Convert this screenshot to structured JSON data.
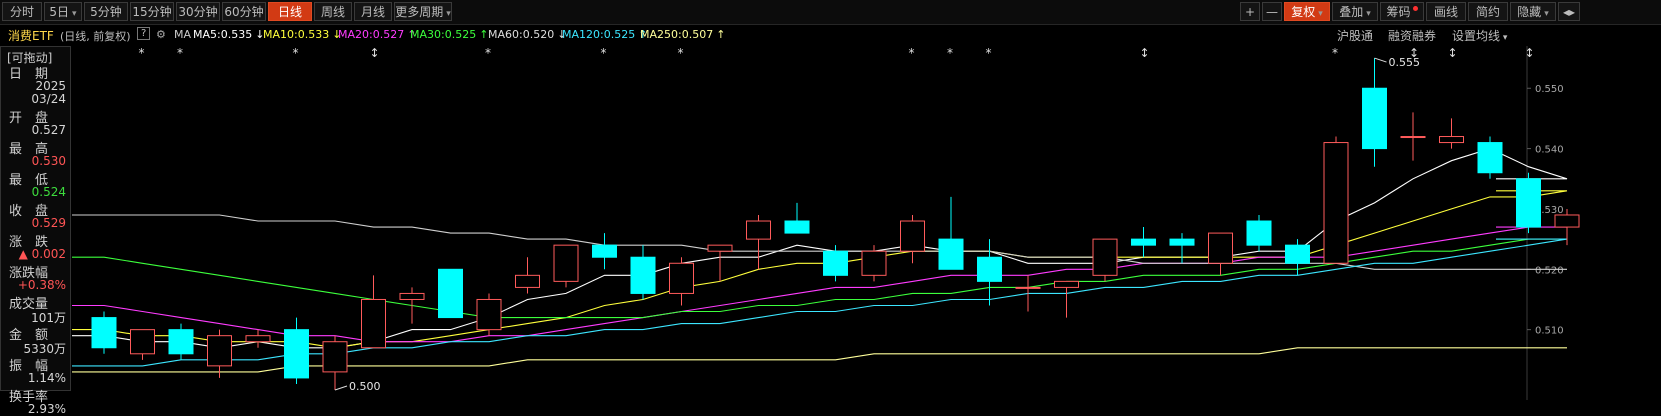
{
  "toolbar": {
    "periods": [
      "分时",
      "5日",
      "5分钟",
      "15分钟",
      "30分钟",
      "60分钟",
      "日线",
      "周线",
      "月线",
      "更多周期"
    ],
    "active_period": "日线",
    "right_buttons": [
      "+",
      "—",
      "复权",
      "叠加",
      "筹码",
      "画线",
      "简约",
      "隐藏",
      "◂▸"
    ]
  },
  "legend": {
    "name": "消费ETF",
    "subtitle": "(日线, 前复权)",
    "help": "?",
    "indicator": "MA",
    "ma": [
      {
        "text": "MA5:0.535",
        "arrow": "↓",
        "color": "#ffffff"
      },
      {
        "text": "MA10:0.533",
        "arrow": "↓",
        "color": "#ffff3c"
      },
      {
        "text": "MA20:0.527",
        "arrow": "↑",
        "color": "#ff3cff"
      },
      {
        "text": "MA30:0.525",
        "arrow": "↑",
        "color": "#3cff3c"
      },
      {
        "text": "MA60:0.520",
        "arrow": "↓",
        "color": "#dddddd"
      },
      {
        "text": "MA120:0.525",
        "arrow": "↑",
        "color": "#3ce6ff"
      },
      {
        "text": "MA250:0.507",
        "arrow": "↑",
        "color": "#ffff9a"
      }
    ],
    "right_links": [
      "沪股通",
      "融资融券",
      "设置均线"
    ]
  },
  "info_panel": {
    "tag": "[可拖动]",
    "rows": [
      {
        "label": "日　期",
        "value": [
          "2025",
          "03/24"
        ],
        "color": "white"
      },
      {
        "label": "开　盘",
        "value": [
          "0.527"
        ],
        "color": "white"
      },
      {
        "label": "最　高",
        "value": [
          "0.530"
        ],
        "color": "red"
      },
      {
        "label": "最　低",
        "value": [
          "0.524"
        ],
        "color": "green"
      },
      {
        "label": "收　盘",
        "value": [
          "0.529"
        ],
        "color": "red"
      },
      {
        "label": "涨　跌",
        "value": [
          "▲ 0.002"
        ],
        "color": "red"
      },
      {
        "label": "涨跌幅",
        "value": [
          "+0.38%"
        ],
        "color": "red"
      },
      {
        "label": "成交量",
        "value": [
          "101万"
        ],
        "color": "white"
      },
      {
        "label": "金　额",
        "value": [
          "5330万"
        ],
        "color": "white"
      },
      {
        "label": "振　幅",
        "value": [
          "1.14%"
        ],
        "color": "white"
      },
      {
        "label": "换手率",
        "value": [
          "2.93%"
        ],
        "color": "white"
      }
    ]
  },
  "chart_data": {
    "type": "candlestick",
    "y_ticks": [
      "0.550",
      "0.540",
      "0.530",
      "0.520",
      "0.510"
    ],
    "ylim": [
      0.5,
      0.557
    ],
    "colors": {
      "up": "#ff5b5b",
      "down": "#00ffff"
    },
    "candles": [
      {
        "o": 0.512,
        "h": 0.513,
        "l": 0.506,
        "c": 0.507
      },
      {
        "o": 0.506,
        "h": 0.51,
        "l": 0.505,
        "c": 0.51
      },
      {
        "o": 0.51,
        "h": 0.511,
        "l": 0.505,
        "c": 0.506
      },
      {
        "o": 0.504,
        "h": 0.51,
        "l": 0.502,
        "c": 0.509
      },
      {
        "o": 0.508,
        "h": 0.51,
        "l": 0.507,
        "c": 0.509
      },
      {
        "o": 0.51,
        "h": 0.512,
        "l": 0.501,
        "c": 0.502
      },
      {
        "o": 0.503,
        "h": 0.509,
        "l": 0.5,
        "c": 0.508
      },
      {
        "o": 0.507,
        "h": 0.519,
        "l": 0.507,
        "c": 0.515
      },
      {
        "o": 0.515,
        "h": 0.517,
        "l": 0.511,
        "c": 0.516
      },
      {
        "o": 0.52,
        "h": 0.52,
        "l": 0.512,
        "c": 0.512
      },
      {
        "o": 0.51,
        "h": 0.516,
        "l": 0.509,
        "c": 0.515
      },
      {
        "o": 0.517,
        "h": 0.522,
        "l": 0.516,
        "c": 0.519
      },
      {
        "o": 0.518,
        "h": 0.524,
        "l": 0.517,
        "c": 0.524
      },
      {
        "o": 0.524,
        "h": 0.526,
        "l": 0.52,
        "c": 0.522
      },
      {
        "o": 0.522,
        "h": 0.524,
        "l": 0.515,
        "c": 0.516
      },
      {
        "o": 0.516,
        "h": 0.522,
        "l": 0.514,
        "c": 0.521
      },
      {
        "o": 0.523,
        "h": 0.524,
        "l": 0.518,
        "c": 0.524
      },
      {
        "o": 0.525,
        "h": 0.529,
        "l": 0.52,
        "c": 0.528
      },
      {
        "o": 0.528,
        "h": 0.531,
        "l": 0.526,
        "c": 0.526
      },
      {
        "o": 0.523,
        "h": 0.524,
        "l": 0.518,
        "c": 0.519
      },
      {
        "o": 0.519,
        "h": 0.524,
        "l": 0.518,
        "c": 0.523
      },
      {
        "o": 0.523,
        "h": 0.529,
        "l": 0.521,
        "c": 0.528
      },
      {
        "o": 0.525,
        "h": 0.532,
        "l": 0.52,
        "c": 0.52
      },
      {
        "o": 0.522,
        "h": 0.525,
        "l": 0.514,
        "c": 0.518
      },
      {
        "o": 0.517,
        "h": 0.519,
        "l": 0.513,
        "c": 0.517
      },
      {
        "o": 0.517,
        "h": 0.518,
        "l": 0.512,
        "c": 0.518
      },
      {
        "o": 0.519,
        "h": 0.525,
        "l": 0.518,
        "c": 0.525
      },
      {
        "o": 0.525,
        "h": 0.527,
        "l": 0.522,
        "c": 0.524
      },
      {
        "o": 0.525,
        "h": 0.526,
        "l": 0.521,
        "c": 0.524
      },
      {
        "o": 0.521,
        "h": 0.526,
        "l": 0.519,
        "c": 0.526
      },
      {
        "o": 0.528,
        "h": 0.529,
        "l": 0.523,
        "c": 0.524
      },
      {
        "o": 0.524,
        "h": 0.525,
        "l": 0.519,
        "c": 0.521
      },
      {
        "o": 0.521,
        "h": 0.542,
        "l": 0.521,
        "c": 0.541
      },
      {
        "o": 0.55,
        "h": 0.555,
        "l": 0.537,
        "c": 0.54
      },
      {
        "o": 0.542,
        "h": 0.546,
        "l": 0.538,
        "c": 0.542
      },
      {
        "o": 0.541,
        "h": 0.545,
        "l": 0.54,
        "c": 0.542
      },
      {
        "o": 0.541,
        "h": 0.542,
        "l": 0.535,
        "c": 0.536
      },
      {
        "o": 0.535,
        "h": 0.536,
        "l": 0.526,
        "c": 0.527
      },
      {
        "o": 0.527,
        "h": 0.53,
        "l": 0.524,
        "c": 0.529
      }
    ],
    "ma_lines": [
      {
        "name": "MA5",
        "color": "#ffffff",
        "values": [
          0.509,
          0.508,
          0.508,
          0.507,
          0.508,
          0.507,
          0.507,
          0.508,
          0.51,
          0.51,
          0.512,
          0.515,
          0.516,
          0.519,
          0.519,
          0.521,
          0.522,
          0.522,
          0.524,
          0.523,
          0.523,
          0.524,
          0.523,
          0.523,
          0.521,
          0.521,
          0.521,
          0.522,
          0.522,
          0.522,
          0.523,
          0.523,
          0.528,
          0.531,
          0.535,
          0.538,
          0.54,
          0.537,
          0.535
        ]
      },
      {
        "name": "MA10",
        "color": "#ffff3c",
        "values": [
          0.51,
          0.509,
          0.509,
          0.508,
          0.508,
          0.508,
          0.507,
          0.508,
          0.508,
          0.509,
          0.51,
          0.511,
          0.512,
          0.514,
          0.515,
          0.517,
          0.518,
          0.52,
          0.521,
          0.521,
          0.522,
          0.523,
          0.523,
          0.523,
          0.522,
          0.522,
          0.522,
          0.522,
          0.522,
          0.522,
          0.522,
          0.522,
          0.524,
          0.526,
          0.528,
          0.53,
          0.532,
          0.532,
          0.533
        ]
      },
      {
        "name": "MA20",
        "color": "#ff3cff",
        "values": [
          0.514,
          0.513,
          0.512,
          0.511,
          0.51,
          0.509,
          0.509,
          0.508,
          0.508,
          0.508,
          0.509,
          0.509,
          0.51,
          0.511,
          0.512,
          0.513,
          0.514,
          0.515,
          0.516,
          0.517,
          0.517,
          0.518,
          0.519,
          0.519,
          0.519,
          0.52,
          0.52,
          0.521,
          0.521,
          0.521,
          0.522,
          0.522,
          0.522,
          0.523,
          0.524,
          0.525,
          0.526,
          0.527,
          0.527
        ]
      },
      {
        "name": "MA30",
        "color": "#3cff3c",
        "values": [
          0.522,
          0.521,
          0.52,
          0.519,
          0.518,
          0.517,
          0.516,
          0.515,
          0.514,
          0.513,
          0.512,
          0.512,
          0.512,
          0.512,
          0.512,
          0.513,
          0.513,
          0.514,
          0.514,
          0.515,
          0.515,
          0.516,
          0.516,
          0.517,
          0.517,
          0.518,
          0.518,
          0.519,
          0.519,
          0.519,
          0.52,
          0.52,
          0.521,
          0.522,
          0.523,
          0.523,
          0.524,
          0.525,
          0.525
        ]
      },
      {
        "name": "MA60",
        "color": "#cfcfcf",
        "values": [
          0.529,
          0.529,
          0.529,
          0.529,
          0.528,
          0.528,
          0.528,
          0.527,
          0.527,
          0.526,
          0.526,
          0.525,
          0.525,
          0.524,
          0.524,
          0.524,
          0.523,
          0.523,
          0.523,
          0.523,
          0.523,
          0.523,
          0.523,
          0.523,
          0.522,
          0.522,
          0.522,
          0.521,
          0.521,
          0.521,
          0.521,
          0.521,
          0.521,
          0.52,
          0.52,
          0.52,
          0.52,
          0.52,
          0.52
        ]
      },
      {
        "name": "MA120",
        "color": "#3ce6ff",
        "values": [
          0.504,
          0.504,
          0.505,
          0.505,
          0.505,
          0.506,
          0.506,
          0.507,
          0.507,
          0.508,
          0.508,
          0.509,
          0.509,
          0.51,
          0.51,
          0.511,
          0.511,
          0.512,
          0.513,
          0.513,
          0.514,
          0.514,
          0.515,
          0.515,
          0.516,
          0.516,
          0.517,
          0.517,
          0.518,
          0.518,
          0.519,
          0.519,
          0.52,
          0.521,
          0.521,
          0.522,
          0.523,
          0.524,
          0.525
        ]
      },
      {
        "name": "MA250",
        "color": "#ffff9a",
        "values": [
          0.503,
          0.503,
          0.503,
          0.503,
          0.503,
          0.504,
          0.504,
          0.504,
          0.504,
          0.504,
          0.504,
          0.505,
          0.505,
          0.505,
          0.505,
          0.505,
          0.505,
          0.505,
          0.505,
          0.505,
          0.506,
          0.506,
          0.506,
          0.506,
          0.506,
          0.506,
          0.506,
          0.506,
          0.506,
          0.506,
          0.506,
          0.507,
          0.507,
          0.507,
          0.507,
          0.507,
          0.507,
          0.507,
          0.507
        ]
      }
    ],
    "annotations": [
      {
        "text": "0.555",
        "candle": 33,
        "at": "high"
      },
      {
        "text": "0.500",
        "candle": 6,
        "at": "low"
      }
    ],
    "top_marks": [
      {
        "candle": 1,
        "sym": "*"
      },
      {
        "candle": 2,
        "sym": "*"
      },
      {
        "candle": 5,
        "sym": "*"
      },
      {
        "candle": 7,
        "sym": "↕"
      },
      {
        "candle": 10,
        "sym": "*"
      },
      {
        "candle": 13,
        "sym": "*"
      },
      {
        "candle": 15,
        "sym": "*"
      },
      {
        "candle": 21,
        "sym": "*"
      },
      {
        "candle": 22,
        "sym": "*"
      },
      {
        "candle": 23,
        "sym": "*"
      },
      {
        "candle": 27,
        "sym": "↕"
      },
      {
        "candle": 32,
        "sym": "*"
      },
      {
        "candle": 34,
        "sym": "↕"
      },
      {
        "candle": 35,
        "sym": "↕"
      },
      {
        "candle": 37,
        "sym": "↕"
      }
    ]
  }
}
